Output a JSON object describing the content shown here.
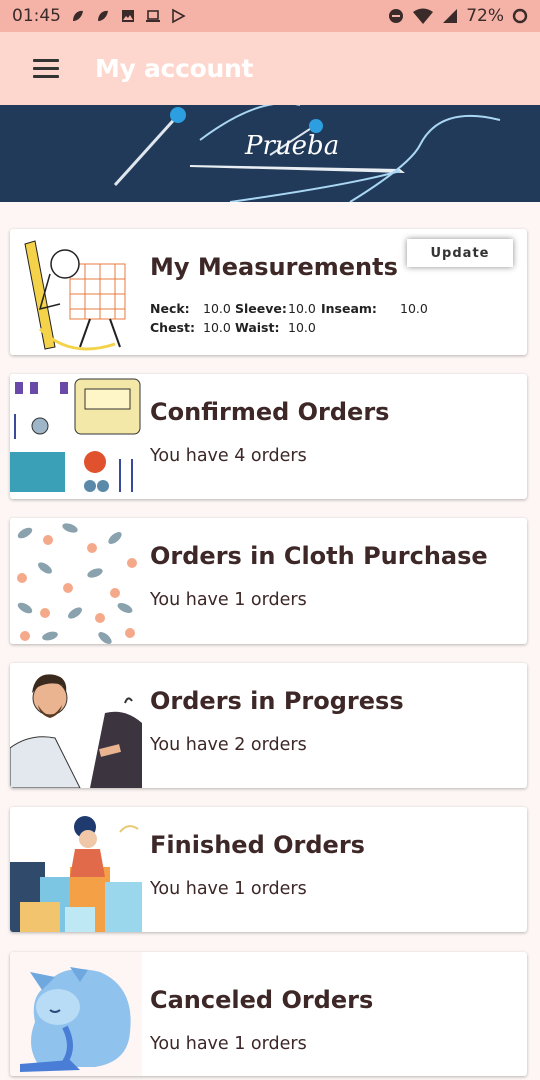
{
  "status_bar": {
    "time": "01:45",
    "battery": "72%",
    "left_icons": [
      "notification-icon",
      "notification-icon",
      "image-icon",
      "laptop-icon",
      "play-store-icon"
    ],
    "right_icons": [
      "dnd-icon",
      "wifi-icon",
      "signal-icon",
      "battery-icon"
    ]
  },
  "app_bar": {
    "title": "My account",
    "menu_icon": "hamburger-menu-icon"
  },
  "banner": {
    "text": "Prueba"
  },
  "measurements": {
    "title": "My Measurements",
    "update_label": "Update",
    "neck_label": "Neck:",
    "neck_value": "10.0",
    "sleeve_label": "Sleeve:",
    "sleeve_value": "10.0",
    "inseam_label": "Inseam:",
    "inseam_value": "10.0",
    "chest_label": "Chest:",
    "chest_value": "10.0",
    "waist_label": "Waist:",
    "waist_value": "10.0"
  },
  "orders": [
    {
      "title": "Confirmed Orders",
      "subtitle": "You have 4 orders"
    },
    {
      "title": "Orders in Cloth Purchase",
      "subtitle": "You have 1 orders"
    },
    {
      "title": "Orders in Progress",
      "subtitle": "You have 2 orders"
    },
    {
      "title": "Finished Orders",
      "subtitle": "You have 1 orders"
    },
    {
      "title": "Canceled Orders",
      "subtitle": "You have 1 orders"
    }
  ],
  "colors": {
    "status_bar": "#f4b3a6",
    "app_bar": "#fdd7cd",
    "banner": "#223a59",
    "background": "#fdf6f4",
    "card_text": "#3d2727"
  }
}
